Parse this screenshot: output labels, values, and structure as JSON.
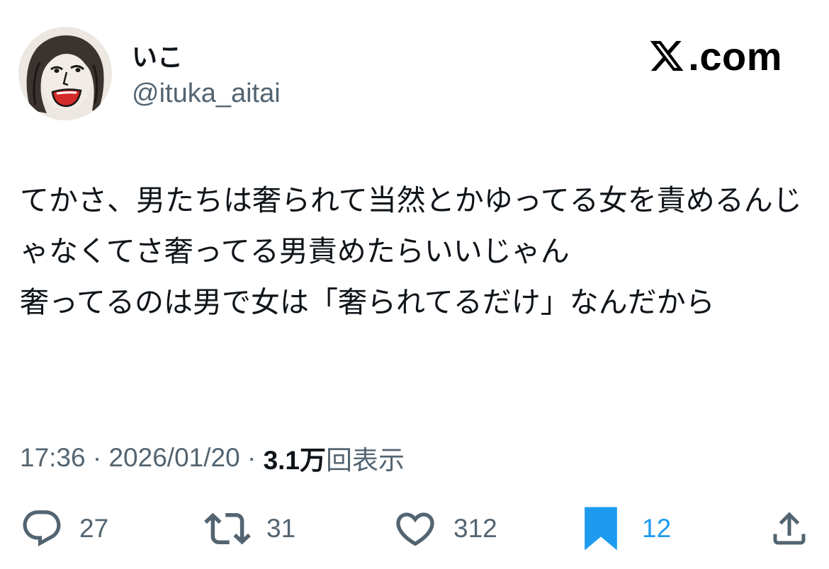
{
  "user": {
    "display_name": "いこ",
    "handle": "@ituka_aitai",
    "avatar_icon": "drawn-face-avatar"
  },
  "brand": {
    "logo_text": ".com",
    "logo_icon": "x-logo-icon"
  },
  "tweet": {
    "text": "てかさ、男たちは奢られて当然とかゆってる女を責めるんじゃなくてさ奢ってる男責めたらいいじゃん\n奢ってるのは男で女は「奢られてるだけ」なんだから"
  },
  "meta": {
    "time": "17:36",
    "separator": " · ",
    "date": "2026/01/20",
    "views_count": "3.1万",
    "views_label": "回表示"
  },
  "actions": {
    "replies": "27",
    "reposts": "31",
    "likes": "312",
    "bookmarks": "12"
  },
  "colors": {
    "text": "#0f1419",
    "secondary": "#536471",
    "accent": "#1d9bf0"
  }
}
